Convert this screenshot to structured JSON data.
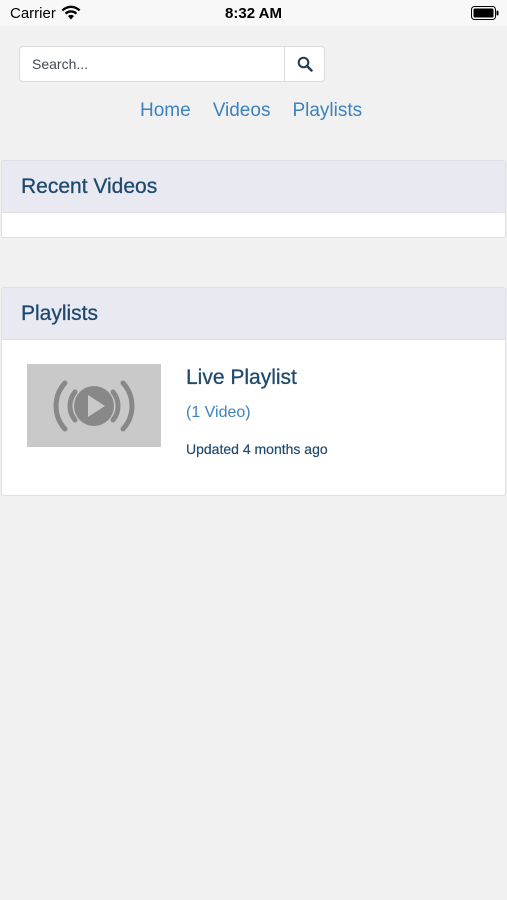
{
  "status_bar": {
    "carrier": "Carrier",
    "time": "8:32 AM",
    "wifi_icon": "wifi-icon",
    "battery_icon": "battery-full-icon"
  },
  "search": {
    "placeholder": "Search...",
    "value": "",
    "button_icon": "search-icon"
  },
  "nav": {
    "items": [
      {
        "label": "Home"
      },
      {
        "label": "Videos"
      },
      {
        "label": "Playlists"
      }
    ]
  },
  "recent_videos": {
    "title": "Recent Videos",
    "items": []
  },
  "playlists": {
    "title": "Playlists",
    "items": [
      {
        "title": "Live Playlist",
        "count": "(1 Video)",
        "updated": "Updated 4 months ago",
        "thumbnail_icon": "live-broadcast-icon"
      }
    ]
  },
  "colors": {
    "link": "#3c82be",
    "heading": "#1e4a6e",
    "panel_header_bg": "#e8e9f1",
    "page_bg": "#f1f1f1"
  }
}
